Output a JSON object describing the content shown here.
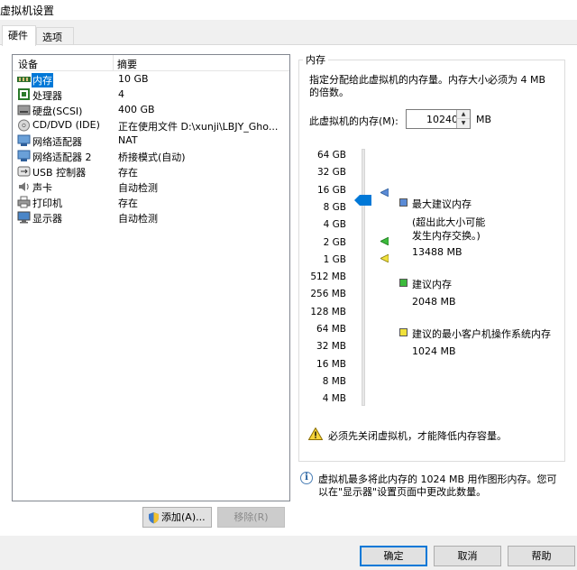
{
  "window": {
    "title": "虚拟机设置"
  },
  "tabs": [
    {
      "label": "硬件"
    },
    {
      "label": "选项"
    }
  ],
  "device_list": {
    "headers": {
      "device": "设备",
      "summary": "摘要"
    },
    "rows": [
      {
        "name": "内存",
        "summary": "10 GB",
        "icon": "memory-icon"
      },
      {
        "name": "处理器",
        "summary": "4",
        "icon": "processor-icon"
      },
      {
        "name": "硬盘(SCSI)",
        "summary": "400 GB",
        "icon": "hard-disk-icon"
      },
      {
        "name": "CD/DVD (IDE)",
        "summary": "正在使用文件 D:\\xunji\\LBJY_Gho...",
        "icon": "cd-dvd-icon"
      },
      {
        "name": "网络适配器",
        "summary": "NAT",
        "icon": "network-adapter-icon"
      },
      {
        "name": "网络适配器 2",
        "summary": "桥接模式(自动)",
        "icon": "network-adapter-icon"
      },
      {
        "name": "USB 控制器",
        "summary": "存在",
        "icon": "usb-icon"
      },
      {
        "name": "声卡",
        "summary": "自动检测",
        "icon": "sound-card-icon"
      },
      {
        "name": "打印机",
        "summary": "存在",
        "icon": "printer-icon"
      },
      {
        "name": "显示器",
        "summary": "自动检测",
        "icon": "display-icon"
      }
    ],
    "add_button": "添加(A)...",
    "remove_button": "移除(R)"
  },
  "memory": {
    "group_title": "内存",
    "description": "指定分配给此虚拟机的内存量。内存大小必须为 4 MB 的倍数。",
    "description_line1": "指定分配给此虚拟机的内存量。内存大小必须为 4 MB",
    "description_line2": "的倍数。",
    "field_label": "此虚拟机的内存(M):",
    "value": "10240",
    "unit": "MB",
    "slider_ticks": [
      "64 GB",
      "32 GB",
      "16 GB",
      "8 GB",
      "4 GB",
      "2 GB",
      "1 GB",
      "512 MB",
      "256 MB",
      "128 MB",
      "64 MB",
      "32 MB",
      "16 MB",
      "8 MB",
      "4 MB"
    ],
    "legend": {
      "max": {
        "title": "最大建议内存",
        "note_line1": "(超出此大小可能",
        "note_line2": "发生内存交换。)",
        "value": "13488 MB",
        "color": "#5b8bd6"
      },
      "recommended": {
        "title": "建议内存",
        "value": "2048 MB",
        "color": "#3cba3c"
      },
      "guest_min": {
        "title": "建议的最小客户机操作系统内存",
        "value": "1024 MB",
        "color": "#f0e13c"
      }
    },
    "warning": "必须先关闭虚拟机，才能降低内存容量。",
    "info_line1": "虚拟机最多将此内存的 1024 MB 用作图形内存。您可",
    "info_line2": "以在\"显示器\"设置页面中更改此数量。"
  },
  "footer": {
    "ok": "确定",
    "cancel": "取消",
    "help": "帮助"
  },
  "colors": {
    "selection": "#0078d7",
    "accent": "#0078d7"
  }
}
